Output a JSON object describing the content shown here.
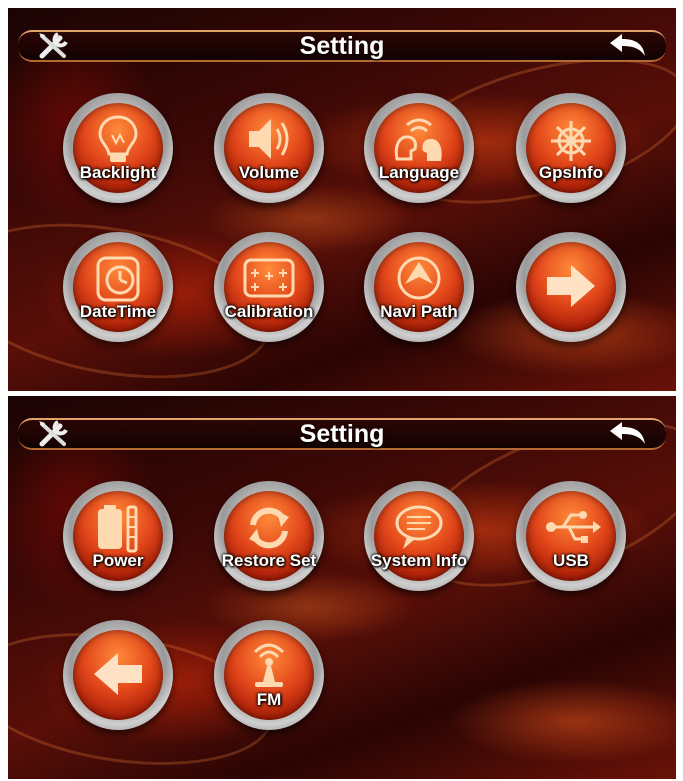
{
  "screen1": {
    "title": "Setting",
    "buttons": [
      {
        "label": "Backlight",
        "icon": "bulb-icon"
      },
      {
        "label": "Volume",
        "icon": "speaker-icon"
      },
      {
        "label": "Language",
        "icon": "speaking-heads-icon"
      },
      {
        "label": "GpsInfo",
        "icon": "satellite-icon"
      },
      {
        "label": "DateTime",
        "icon": "clock-icon"
      },
      {
        "label": "Calibration",
        "icon": "crosshair-grid-icon"
      },
      {
        "label": "Navi Path",
        "icon": "navigation-arrow-icon"
      },
      {
        "label": "",
        "icon": "next-arrow-icon"
      }
    ]
  },
  "screen2": {
    "title": "Setting",
    "buttons": [
      {
        "label": "Power",
        "icon": "battery-icon"
      },
      {
        "label": "Restore Set",
        "icon": "refresh-icon"
      },
      {
        "label": "System Info",
        "icon": "speech-bubble-icon"
      },
      {
        "label": "USB",
        "icon": "usb-icon"
      },
      {
        "label": "",
        "icon": "previous-arrow-icon"
      },
      {
        "label": "FM",
        "icon": "antenna-icon"
      }
    ]
  },
  "colors": {
    "accent": "#e2461a",
    "bar_edge": "#e0a46a",
    "background": "#3a0806"
  }
}
